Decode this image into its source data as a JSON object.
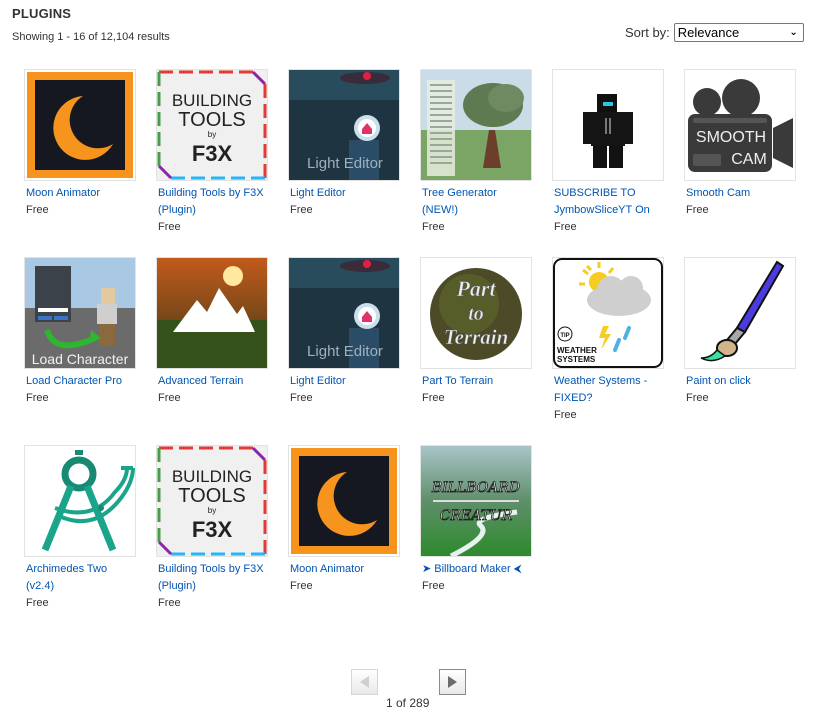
{
  "header": {
    "title": "PLUGINS",
    "results_text": "Showing 1 - 16 of 12,104 results",
    "sort_label": "Sort by:",
    "sort_selected": "Relevance"
  },
  "items": [
    {
      "name": "Moon Animator",
      "price": "Free",
      "icon": "moon-animator-thumbnail"
    },
    {
      "name": "Building Tools by F3X (Plugin)",
      "price": "Free",
      "icon": "building-tools-thumbnail"
    },
    {
      "name": "Light Editor",
      "price": "Free",
      "icon": "light-editor-thumbnail"
    },
    {
      "name": "Tree Generator (NEW!)",
      "price": "Free",
      "icon": "tree-generator-thumbnail"
    },
    {
      "name": "SUBSCRIBE TO JymbowSliceYT On",
      "price": "Free",
      "icon": "avatar-thumbnail"
    },
    {
      "name": "Smooth Cam",
      "price": "Free",
      "icon": "smooth-cam-thumbnail"
    },
    {
      "name": "Load Character Pro",
      "price": "Free",
      "icon": "load-character-thumbnail"
    },
    {
      "name": "Advanced Terrain",
      "price": "Free",
      "icon": "advanced-terrain-thumbnail"
    },
    {
      "name": "Light Editor",
      "price": "Free",
      "icon": "light-editor-thumbnail"
    },
    {
      "name": "Part To Terrain",
      "price": "Free",
      "icon": "part-to-terrain-thumbnail"
    },
    {
      "name": "Weather Systems - FIXED?",
      "price": "Free",
      "icon": "weather-systems-thumbnail"
    },
    {
      "name": "Paint on click",
      "price": "Free",
      "icon": "paintbrush-thumbnail"
    },
    {
      "name": "Archimedes Two (v2.4)",
      "price": "Free",
      "icon": "archimedes-compass-thumbnail"
    },
    {
      "name": "Building Tools by F3X (Plugin)",
      "price": "Free",
      "icon": "building-tools-thumbnail"
    },
    {
      "name": "Moon Animator",
      "price": "Free",
      "icon": "moon-animator-thumbnail"
    },
    {
      "name": "➤ Billboard Maker ⮜",
      "price": "Free",
      "icon": "billboard-maker-thumbnail"
    }
  ],
  "thumb_text": {
    "light_editor": "Light Editor",
    "building": "BUILDING",
    "tools": "TOOLS",
    "by": "by",
    "f3x": "F3X",
    "smooth": "SMOOTH",
    "cam": "CAM",
    "load_character": "Load Character",
    "part": "Part",
    "to": "to",
    "terrain": "Terrain",
    "weather": "WEATHER",
    "systems": "SYSTEMS",
    "tip": "TIP",
    "billboard": "BILLBOARD",
    "creatur": "CREATUR"
  },
  "pagination": {
    "page_text": "1 of 289",
    "current_page": 1,
    "total_pages": 289
  },
  "colors": {
    "link": "#0055b3",
    "text": "#343434"
  }
}
